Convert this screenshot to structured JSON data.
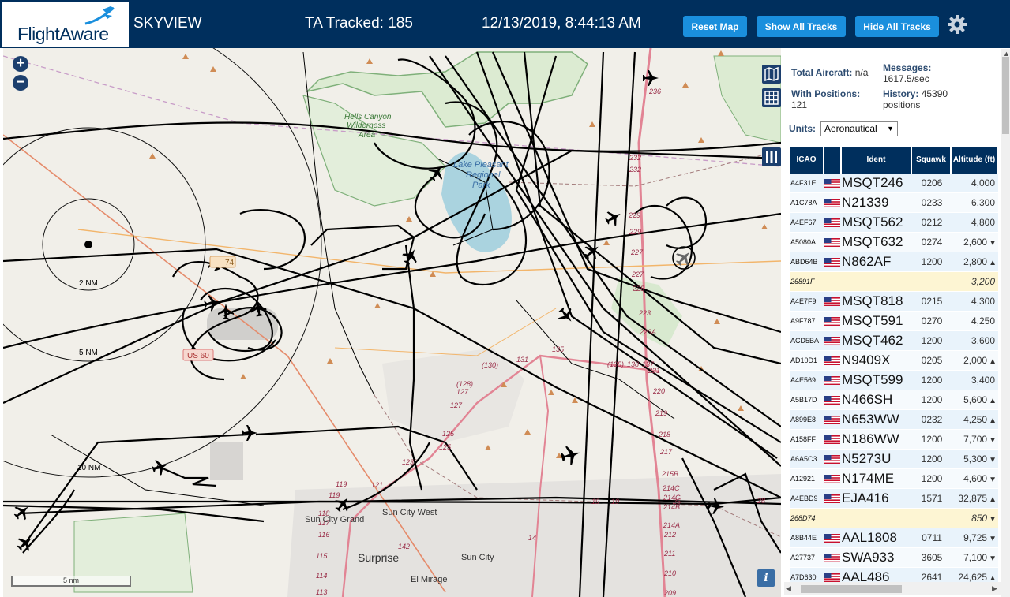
{
  "header": {
    "logo_text": "FlightAware",
    "app_title": "SKYVIEW",
    "tracked": "TA Tracked: 185",
    "datetime": "12/13/2019, 8:44:13 AM",
    "btn_reset": "Reset Map",
    "btn_show": "Show All Tracks",
    "btn_hide": "Hide All Tracks"
  },
  "map": {
    "labels": {
      "hells_canyon": "Hells Canyon",
      "wilderness": "Wilderness",
      "area": "Area",
      "lake_pleasant": "Lake Pleasant",
      "lake2": "Regional",
      "lake3": "Park",
      "range_2": "2 NM",
      "range_5": "5 NM",
      "range_10": "10 NM",
      "us60": "US 60",
      "r74": "74",
      "sun_city_grand": "Sun City Grand",
      "sun_city_west": "Sun City West",
      "sun_city": "Sun City",
      "surprise": "Surprise",
      "el_mirage": "El Mirage",
      "scale": "5 nm",
      "info": "i"
    },
    "road_numbers": [
      "236",
      "232",
      "232",
      "229",
      "229",
      "227",
      "227",
      "225",
      "223",
      "223A",
      "221",
      "220",
      "219",
      "218",
      "217",
      "215B",
      "214C",
      "214C",
      "214B",
      "214A",
      "212",
      "211",
      "210",
      "209",
      "135",
      "131",
      "(130)",
      "(128)",
      "127",
      "127",
      "125",
      "125",
      "123",
      "121",
      "119",
      "119",
      "118",
      "117",
      "116",
      "115",
      "114",
      "113",
      "142",
      "14",
      "19",
      "19",
      "25",
      "(135)",
      "138",
      "137",
      "28"
    ]
  },
  "panel": {
    "total_label": "Total Aircraft:",
    "total_value": "n/a",
    "messages_label": "Messages:",
    "messages_value": "1617.5/sec",
    "positions_label": "With Positions:",
    "positions_value": "121",
    "history_label": "History:",
    "history_value": "45390",
    "history_unit": "positions",
    "units_label": "Units:",
    "units_value": "Aeronautical"
  },
  "table": {
    "headers": [
      "ICAO",
      "Ident",
      "Squawk",
      "Altitude (ft)"
    ],
    "rows": [
      {
        "icao": "A4F31E",
        "ident": "MSQT246",
        "squawk": "0206",
        "alt": "4,000",
        "trend": ""
      },
      {
        "icao": "A1C78A",
        "ident": "N21339",
        "squawk": "0233",
        "alt": "6,300",
        "trend": ""
      },
      {
        "icao": "A4EF67",
        "ident": "MSQT562",
        "squawk": "0212",
        "alt": "4,800",
        "trend": ""
      },
      {
        "icao": "A5080A",
        "ident": "MSQT632",
        "squawk": "0274",
        "alt": "2,600",
        "trend": "▼"
      },
      {
        "icao": "ABD64B",
        "ident": "N862AF",
        "squawk": "1200",
        "alt": "2,800",
        "trend": "▲"
      },
      {
        "icao": "26891F",
        "ident": "",
        "squawk": "",
        "alt": "3,200",
        "trend": ""
      },
      {
        "icao": "A4E7F9",
        "ident": "MSQT818",
        "squawk": "0215",
        "alt": "4,300",
        "trend": ""
      },
      {
        "icao": "A9F787",
        "ident": "MSQT591",
        "squawk": "0270",
        "alt": "4,250",
        "trend": ""
      },
      {
        "icao": "ACD5BA",
        "ident": "MSQT462",
        "squawk": "1200",
        "alt": "3,600",
        "trend": ""
      },
      {
        "icao": "AD10D1",
        "ident": "N9409X",
        "squawk": "0205",
        "alt": "2,000",
        "trend": "▲"
      },
      {
        "icao": "A4E569",
        "ident": "MSQT599",
        "squawk": "1200",
        "alt": "3,400",
        "trend": ""
      },
      {
        "icao": "A5B17D",
        "ident": "N466SH",
        "squawk": "1200",
        "alt": "5,600",
        "trend": "▲"
      },
      {
        "icao": "A899E8",
        "ident": "N653WW",
        "squawk": "0232",
        "alt": "4,250",
        "trend": "▲"
      },
      {
        "icao": "A158FF",
        "ident": "N186WW",
        "squawk": "1200",
        "alt": "7,700",
        "trend": "▼"
      },
      {
        "icao": "A6A5C3",
        "ident": "N5273U",
        "squawk": "1200",
        "alt": "5,300",
        "trend": "▼"
      },
      {
        "icao": "A12921",
        "ident": "N174ME",
        "squawk": "1200",
        "alt": "4,600",
        "trend": "▼"
      },
      {
        "icao": "A4EBD9",
        "ident": "EJA416",
        "squawk": "1571",
        "alt": "32,875",
        "trend": "▲"
      },
      {
        "icao": "268D74",
        "ident": "",
        "squawk": "",
        "alt": "850",
        "trend": "▼"
      },
      {
        "icao": "A8B44E",
        "ident": "AAL1808",
        "squawk": "0711",
        "alt": "9,725",
        "trend": "▼"
      },
      {
        "icao": "A27737",
        "ident": "SWA933",
        "squawk": "3605",
        "alt": "7,100",
        "trend": "▼"
      },
      {
        "icao": "A7D630",
        "ident": "AAL486",
        "squawk": "2641",
        "alt": "24,625",
        "trend": "▲"
      }
    ]
  },
  "colors": {
    "header_bg": "#002f5d",
    "button_blue": "#1a8fdd",
    "map_bg": "#f1efe9",
    "row_blue": "#e9f3fb",
    "row_yellow": "#fdf5d3"
  },
  "icons": [
    "gear-icon",
    "zoom-in-icon",
    "zoom-out-icon",
    "map-layer-icon",
    "grid-icon",
    "columns-icon",
    "info-icon",
    "plane-icon",
    "us-flag-icon"
  ]
}
